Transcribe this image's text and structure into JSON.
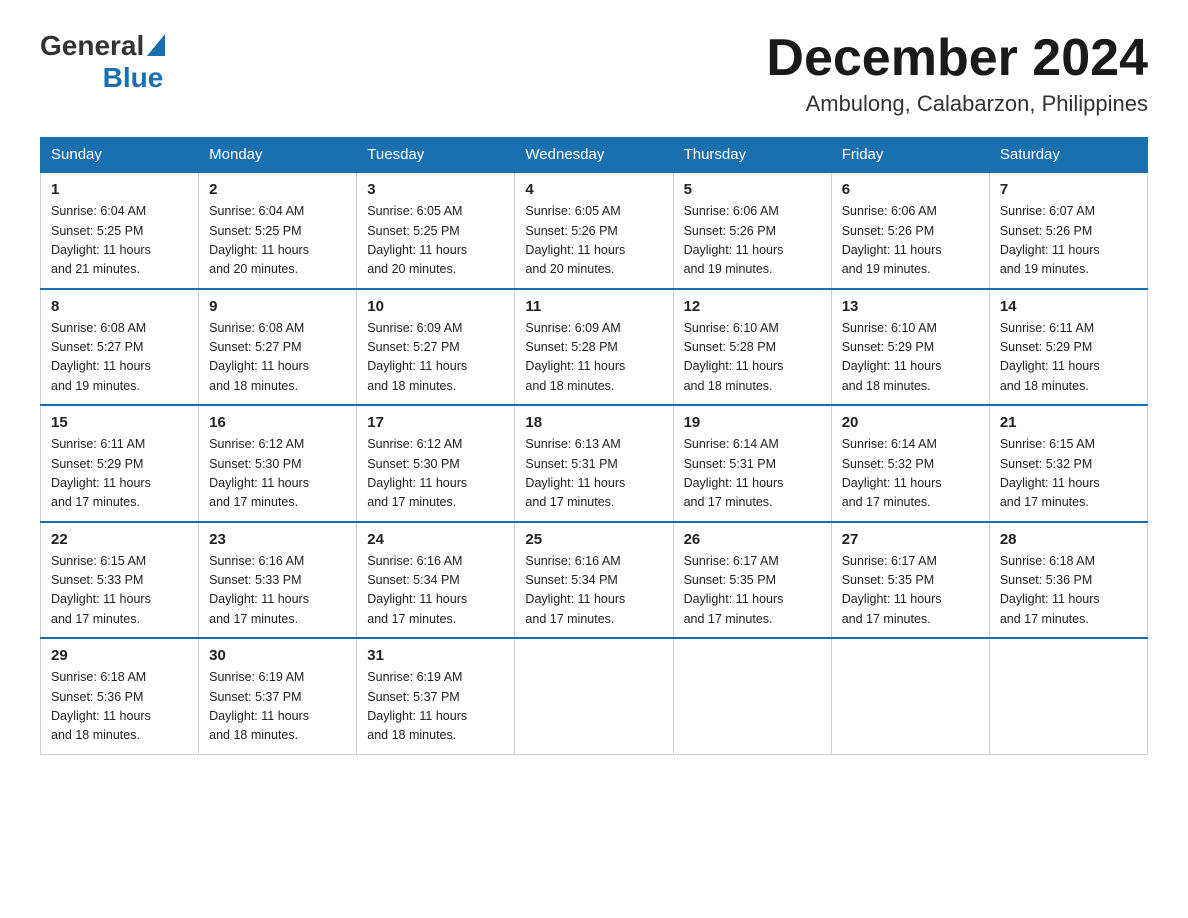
{
  "header": {
    "logo_general": "General",
    "logo_blue": "Blue",
    "title": "December 2024",
    "subtitle": "Ambulong, Calabarzon, Philippines"
  },
  "days_of_week": [
    "Sunday",
    "Monday",
    "Tuesday",
    "Wednesday",
    "Thursday",
    "Friday",
    "Saturday"
  ],
  "weeks": [
    [
      {
        "day": "1",
        "sunrise": "6:04 AM",
        "sunset": "5:25 PM",
        "daylight": "11 hours and 21 minutes."
      },
      {
        "day": "2",
        "sunrise": "6:04 AM",
        "sunset": "5:25 PM",
        "daylight": "11 hours and 20 minutes."
      },
      {
        "day": "3",
        "sunrise": "6:05 AM",
        "sunset": "5:25 PM",
        "daylight": "11 hours and 20 minutes."
      },
      {
        "day": "4",
        "sunrise": "6:05 AM",
        "sunset": "5:26 PM",
        "daylight": "11 hours and 20 minutes."
      },
      {
        "day": "5",
        "sunrise": "6:06 AM",
        "sunset": "5:26 PM",
        "daylight": "11 hours and 19 minutes."
      },
      {
        "day": "6",
        "sunrise": "6:06 AM",
        "sunset": "5:26 PM",
        "daylight": "11 hours and 19 minutes."
      },
      {
        "day": "7",
        "sunrise": "6:07 AM",
        "sunset": "5:26 PM",
        "daylight": "11 hours and 19 minutes."
      }
    ],
    [
      {
        "day": "8",
        "sunrise": "6:08 AM",
        "sunset": "5:27 PM",
        "daylight": "11 hours and 19 minutes."
      },
      {
        "day": "9",
        "sunrise": "6:08 AM",
        "sunset": "5:27 PM",
        "daylight": "11 hours and 18 minutes."
      },
      {
        "day": "10",
        "sunrise": "6:09 AM",
        "sunset": "5:27 PM",
        "daylight": "11 hours and 18 minutes."
      },
      {
        "day": "11",
        "sunrise": "6:09 AM",
        "sunset": "5:28 PM",
        "daylight": "11 hours and 18 minutes."
      },
      {
        "day": "12",
        "sunrise": "6:10 AM",
        "sunset": "5:28 PM",
        "daylight": "11 hours and 18 minutes."
      },
      {
        "day": "13",
        "sunrise": "6:10 AM",
        "sunset": "5:29 PM",
        "daylight": "11 hours and 18 minutes."
      },
      {
        "day": "14",
        "sunrise": "6:11 AM",
        "sunset": "5:29 PM",
        "daylight": "11 hours and 18 minutes."
      }
    ],
    [
      {
        "day": "15",
        "sunrise": "6:11 AM",
        "sunset": "5:29 PM",
        "daylight": "11 hours and 17 minutes."
      },
      {
        "day": "16",
        "sunrise": "6:12 AM",
        "sunset": "5:30 PM",
        "daylight": "11 hours and 17 minutes."
      },
      {
        "day": "17",
        "sunrise": "6:12 AM",
        "sunset": "5:30 PM",
        "daylight": "11 hours and 17 minutes."
      },
      {
        "day": "18",
        "sunrise": "6:13 AM",
        "sunset": "5:31 PM",
        "daylight": "11 hours and 17 minutes."
      },
      {
        "day": "19",
        "sunrise": "6:14 AM",
        "sunset": "5:31 PM",
        "daylight": "11 hours and 17 minutes."
      },
      {
        "day": "20",
        "sunrise": "6:14 AM",
        "sunset": "5:32 PM",
        "daylight": "11 hours and 17 minutes."
      },
      {
        "day": "21",
        "sunrise": "6:15 AM",
        "sunset": "5:32 PM",
        "daylight": "11 hours and 17 minutes."
      }
    ],
    [
      {
        "day": "22",
        "sunrise": "6:15 AM",
        "sunset": "5:33 PM",
        "daylight": "11 hours and 17 minutes."
      },
      {
        "day": "23",
        "sunrise": "6:16 AM",
        "sunset": "5:33 PM",
        "daylight": "11 hours and 17 minutes."
      },
      {
        "day": "24",
        "sunrise": "6:16 AM",
        "sunset": "5:34 PM",
        "daylight": "11 hours and 17 minutes."
      },
      {
        "day": "25",
        "sunrise": "6:16 AM",
        "sunset": "5:34 PM",
        "daylight": "11 hours and 17 minutes."
      },
      {
        "day": "26",
        "sunrise": "6:17 AM",
        "sunset": "5:35 PM",
        "daylight": "11 hours and 17 minutes."
      },
      {
        "day": "27",
        "sunrise": "6:17 AM",
        "sunset": "5:35 PM",
        "daylight": "11 hours and 17 minutes."
      },
      {
        "day": "28",
        "sunrise": "6:18 AM",
        "sunset": "5:36 PM",
        "daylight": "11 hours and 17 minutes."
      }
    ],
    [
      {
        "day": "29",
        "sunrise": "6:18 AM",
        "sunset": "5:36 PM",
        "daylight": "11 hours and 18 minutes."
      },
      {
        "day": "30",
        "sunrise": "6:19 AM",
        "sunset": "5:37 PM",
        "daylight": "11 hours and 18 minutes."
      },
      {
        "day": "31",
        "sunrise": "6:19 AM",
        "sunset": "5:37 PM",
        "daylight": "11 hours and 18 minutes."
      },
      null,
      null,
      null,
      null
    ]
  ],
  "labels": {
    "sunrise": "Sunrise:",
    "sunset": "Sunset:",
    "daylight": "Daylight:"
  }
}
